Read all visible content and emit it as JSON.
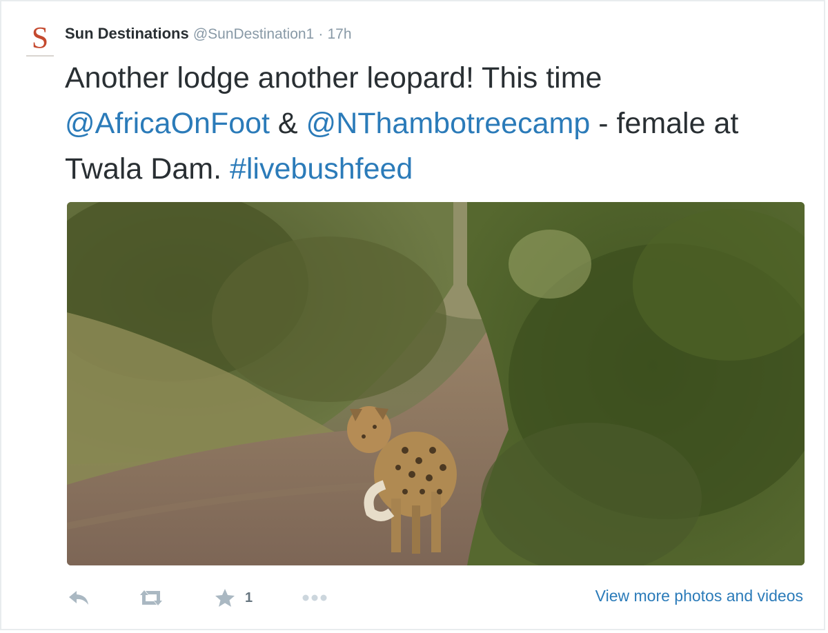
{
  "tweet": {
    "avatar_letter": "S",
    "display_name": "Sun Destinations",
    "handle": "@SunDestination1",
    "separator": "·",
    "timestamp": "17h",
    "text": {
      "part1": "Another lodge another leopard! This time ",
      "mention1": "@AfricaOnFoot",
      "part2": " & ",
      "mention2": "@NThambotreecamp",
      "part3": " - female at Twala Dam. ",
      "hashtag": "#livebushfeed"
    },
    "favorite_count": "1",
    "view_more_label": "View more photos and videos"
  },
  "colors": {
    "link": "#2b7bb9",
    "action_icon": "#aab8c2",
    "brand_s": "#c4492e"
  },
  "icons": [
    "reply-icon",
    "retweet-icon",
    "favorite-star-icon",
    "more-dots-icon"
  ]
}
